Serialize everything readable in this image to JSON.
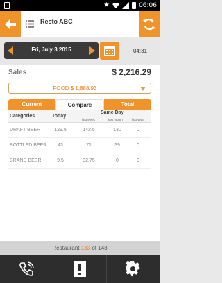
{
  "status": {
    "time": "06:06"
  },
  "header": {
    "title": "Resto ABC"
  },
  "datebar": {
    "date": "Fri, July 3 2015",
    "time": "04:31"
  },
  "sales": {
    "label": "Sales",
    "value": "$ 2,216.29",
    "dropdown": "FOOD $ 1,888.93"
  },
  "tabs": [
    {
      "label": "Current"
    },
    {
      "label": "Compare"
    },
    {
      "label": "Total"
    }
  ],
  "table": {
    "headers": {
      "categories": "Categories",
      "today": "Today",
      "same_day": "Same Day",
      "last_week": "last week",
      "last_month": "last month",
      "last_year": "last year"
    },
    "rows": [
      {
        "category": "DRAFT BEER",
        "today": "129.5",
        "last_week": "142.5",
        "last_month": "130",
        "last_year": "0"
      },
      {
        "category": "BOTTLED BEER",
        "today": "43",
        "last_week": "71",
        "last_month": "39",
        "last_year": "0"
      },
      {
        "category": "BRAND BEER",
        "today": "9.5",
        "last_week": "32.75",
        "last_month": "0",
        "last_year": "0"
      }
    ]
  },
  "footer": {
    "prefix": "Restaurant",
    "current": "133",
    "middle": "of",
    "total": "143"
  },
  "colors": {
    "accent": "#f0932b",
    "dark": "#2d2d2d"
  },
  "icons": {
    "back": "back-arrow-icon",
    "menu": "list-menu-icon",
    "refresh": "refresh-icon",
    "calendar": "calendar-icon",
    "phone": "phone-icon",
    "alert": "exclamation-icon",
    "settings": "gear-icon"
  }
}
